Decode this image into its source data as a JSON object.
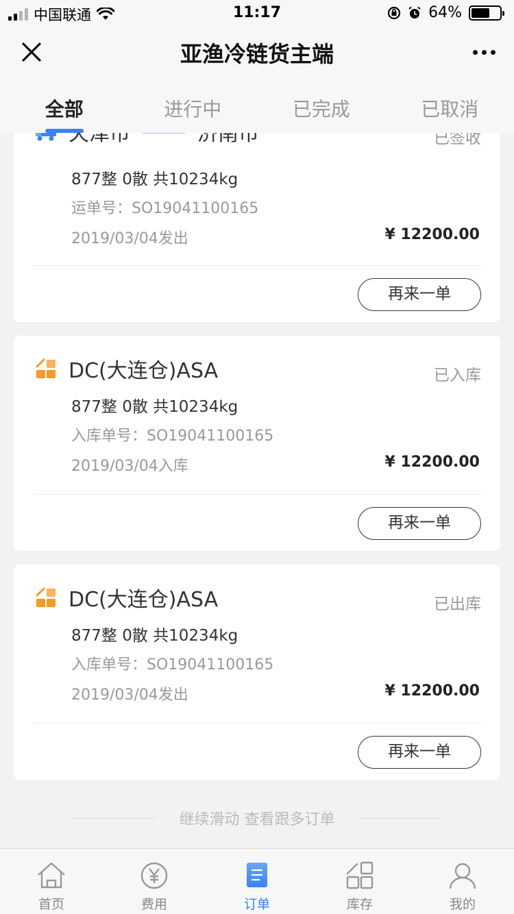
{
  "status_bar": {
    "carrier": "中国联通",
    "time": "11:17",
    "battery_percent": "64%",
    "battery_level": 0.64
  },
  "nav": {
    "title": "亚渔冷链货主端"
  },
  "tabs": [
    {
      "label": "全部",
      "active": true
    },
    {
      "label": "进行中",
      "active": false
    },
    {
      "label": "已完成",
      "active": false
    },
    {
      "label": "已取消",
      "active": false
    }
  ],
  "orders": [
    {
      "type": "transport",
      "from": "天津市",
      "to": "济南市",
      "status": "已签收",
      "quantity": "877整  0散  共10234kg",
      "order_no": "运单号：SO19041100165",
      "date": "2019/03/04发出",
      "price": "¥ 12200.00",
      "button": "再来一单"
    },
    {
      "type": "warehouse",
      "title": "DC(大连仓)ASA",
      "status": "已入库",
      "quantity": "877整  0散  共10234kg",
      "order_no": "入库单号：SO19041100165",
      "date": "2019/03/04入库",
      "price": "¥ 12200.00",
      "button": "再来一单"
    },
    {
      "type": "warehouse",
      "title": "DC(大连仓)ASA",
      "status": "已出库",
      "quantity": "877整  0散  共10234kg",
      "order_no": "入库单号：SO19041100165",
      "date": "2019/03/04发出",
      "price": "¥ 12200.00",
      "button": "再来一单"
    }
  ],
  "more_hint": "继续滑动  查看跟多订单",
  "tab_bar": [
    {
      "label": "首页",
      "icon": "home-icon",
      "active": false
    },
    {
      "label": "费用",
      "icon": "yen-icon",
      "active": false
    },
    {
      "label": "订单",
      "icon": "order-icon",
      "active": true
    },
    {
      "label": "库存",
      "icon": "inventory-icon",
      "active": false
    },
    {
      "label": "我的",
      "icon": "user-icon",
      "active": false
    }
  ],
  "colors": {
    "accent": "#3b82f6",
    "warehouse_icon": "#f59a23"
  }
}
